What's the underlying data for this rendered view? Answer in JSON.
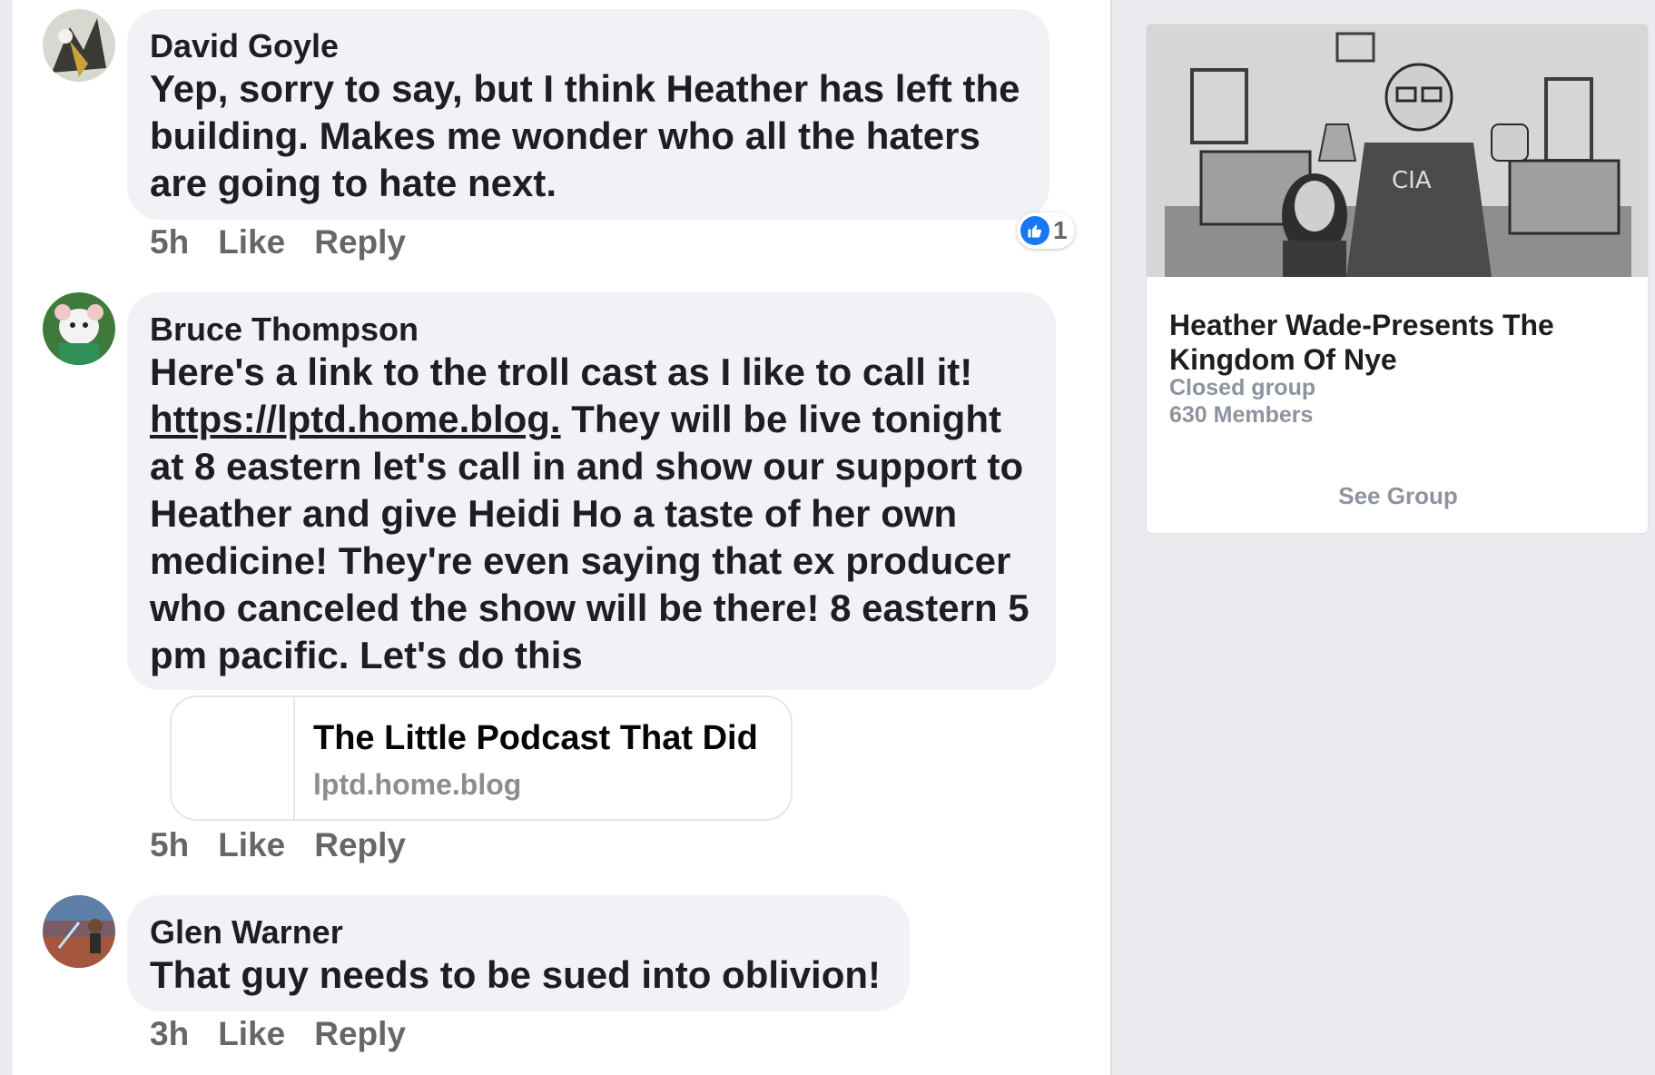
{
  "comments": [
    {
      "author": "David Goyle",
      "text": "Yep, sorry to say, but I think Heather has left the building. Makes me wonder who all the haters are going to hate next.",
      "time": "5h",
      "like_label": "Like",
      "reply_label": "Reply",
      "reaction_count": "1",
      "reaction_icon": "thumbs-up-icon"
    },
    {
      "author": "Bruce Thompson",
      "text_before_link": "Here's a link to the troll cast as I like to call it! ",
      "link_text": "https://lptd.home.blog.",
      "text_after_link": "  They will be live tonight at 8 eastern let's call in and show our support to Heather and give Heidi Ho a taste of her own medicine! They're even saying that ex producer who canceled the show will be there!  8 eastern 5 pm pacific. Let's do this",
      "link_preview": {
        "title": "The Little Podcast That Did",
        "domain": "lptd.home.blog"
      },
      "time": "5h",
      "like_label": "Like",
      "reply_label": "Reply"
    },
    {
      "author": "Glen Warner",
      "text": "That guy needs to be sued into oblivion!",
      "time": "3h",
      "like_label": "Like",
      "reply_label": "Reply"
    }
  ],
  "group_card": {
    "name": "Heather Wade-Presents The Kingdom Of Nye",
    "type": "Closed group",
    "members": "630 Members",
    "button_label": "See Group"
  },
  "colors": {
    "like_blue": "#1877f2",
    "bubble_bg": "#f0f2f5",
    "meta_gray": "#65676b"
  }
}
